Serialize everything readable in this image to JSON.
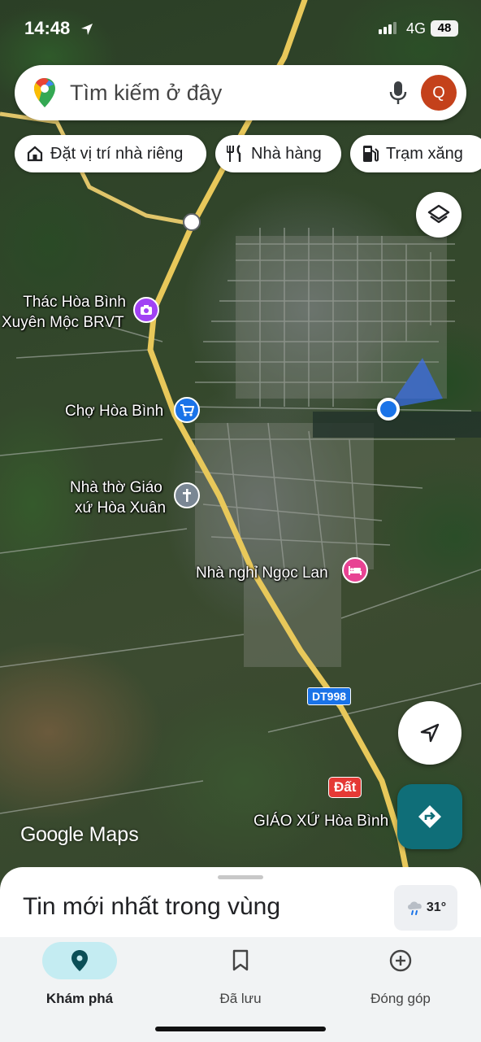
{
  "status_bar": {
    "time": "14:48",
    "network": "4G",
    "battery": "48"
  },
  "search": {
    "placeholder": "Tìm kiếm ở đây",
    "avatar_letter": "Q"
  },
  "chips": [
    {
      "label": "Đặt vị trí nhà riêng",
      "icon": "home-icon"
    },
    {
      "label": "Nhà hàng",
      "icon": "restaurant-icon"
    },
    {
      "label": "Trạm xăng",
      "icon": "gas-station-icon"
    }
  ],
  "map": {
    "pois": [
      {
        "line1": "Thác Hòa Bình",
        "line2": "Xuyên Mộc BRVT",
        "icon": "camera-icon"
      },
      {
        "label": "Chợ Hòa Bình",
        "icon": "shopping-cart-icon"
      },
      {
        "line1": "Nhà thờ Giáo",
        "line2": "xứ Hòa Xuân",
        "icon": "church-cross-icon"
      },
      {
        "label": "Nhà nghỉ Ngọc Lan",
        "icon": "hotel-bed-icon"
      },
      {
        "label": "GIÁO XỨ Hòa Bình"
      }
    ],
    "road_label": "DT998",
    "land_badge": "Đất",
    "logo_google": "Google",
    "logo_maps": "Maps"
  },
  "sheet": {
    "title": "Tin mới nhất trong vùng",
    "weather_temp": "31°"
  },
  "nav": {
    "explore": "Khám phá",
    "saved": "Đã lưu",
    "contribute": "Đóng góp"
  },
  "colors": {
    "accent_teal": "#0f6e78",
    "avatar_bg": "#c4411b",
    "road_yellow": "#e8c85a",
    "location_blue": "#1a73e8"
  }
}
